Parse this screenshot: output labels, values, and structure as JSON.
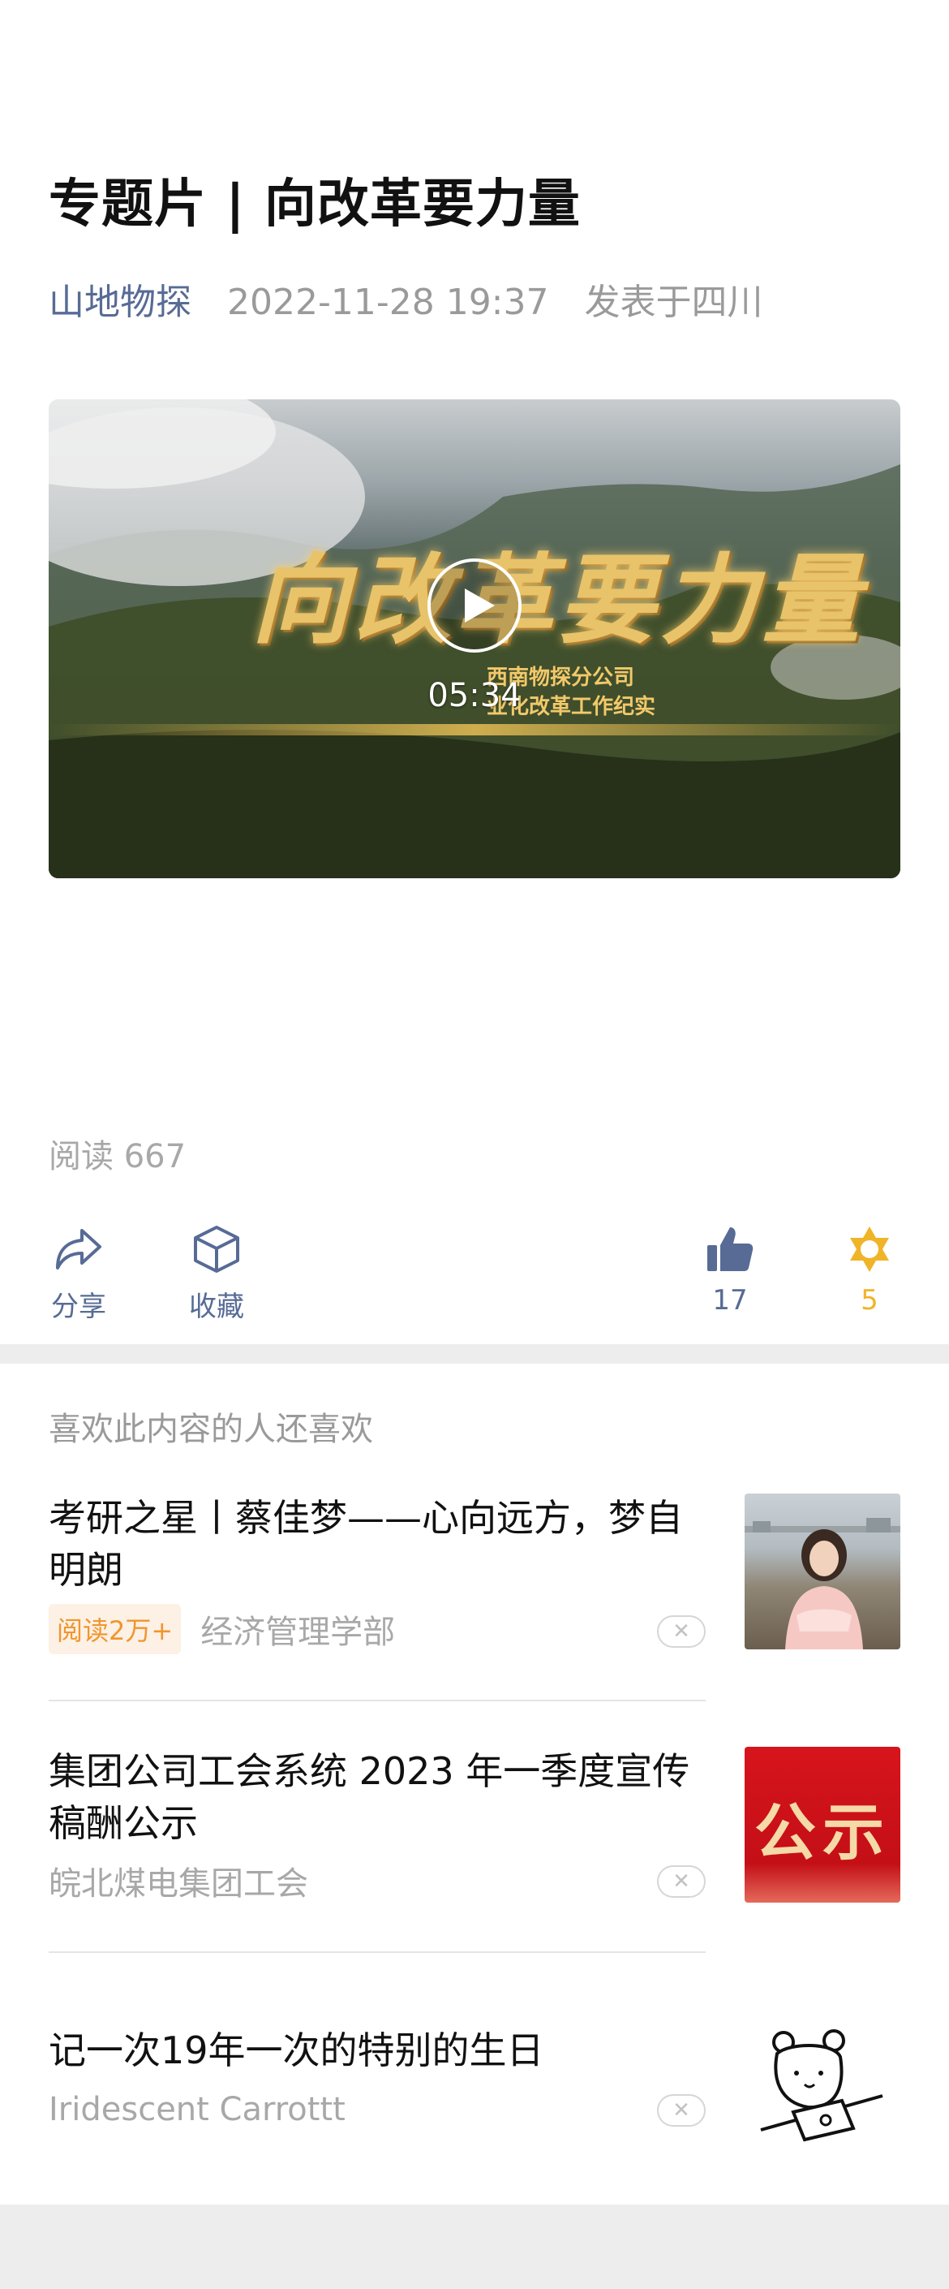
{
  "article": {
    "title": "专题片 | 向改革要力量",
    "author": "山地物探",
    "date": "2022-11-28 19:37",
    "location": "发表于四川"
  },
  "video": {
    "title_art": "向改革要力量",
    "subtitle_line1": "西南物探分公司",
    "subtitle_line2": "业化改革工作纪实",
    "duration": "05:34"
  },
  "stats": {
    "reads": "阅读 667"
  },
  "actions": {
    "share_label": "分享",
    "favorite_label": "收藏",
    "like_count": "17",
    "wow_count": "5"
  },
  "recommend": {
    "heading": "喜欢此内容的人还喜欢",
    "items": [
      {
        "title": "考研之星丨蔡佳梦——心向远方，梦自明朗",
        "badge": "阅读2万+",
        "source": "经济管理学部"
      },
      {
        "title": "集团公司工会系统 2023 年一季度宣传稿酬公示",
        "source": "皖北煤电集团工会",
        "thumb_text": "公示"
      },
      {
        "title": "记一次19年一次的特别的生日",
        "source": "Iridescent Carrottt"
      }
    ]
  },
  "colors": {
    "author_link": "#576b95",
    "badge_text": "#f0962e",
    "wow_accent": "#f0b429"
  },
  "icons": {
    "share": "share-arrow-icon",
    "favorite": "cube-icon",
    "like": "thumbs-up-icon",
    "wow": "sparkle-icon",
    "play": "play-icon",
    "close": "close-icon"
  }
}
